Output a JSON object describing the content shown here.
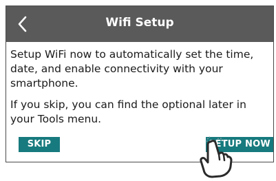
{
  "header": {
    "title": "Wifi Setup",
    "back_icon": "chevron-left-icon"
  },
  "body": {
    "paragraph1": "Setup WiFi now to automatically set the time, date, and enable connectivity with your smartphone.",
    "paragraph2": "If you skip, you can find the optional later in your Tools menu."
  },
  "actions": {
    "skip_label": "SKIP",
    "setup_label": "SETUP NOW"
  },
  "colors": {
    "header_bg": "#5a5a5a",
    "button_bg": "#177a7e",
    "text": "#1a1a1a"
  },
  "overlay": {
    "icon": "tap-hand-icon"
  }
}
